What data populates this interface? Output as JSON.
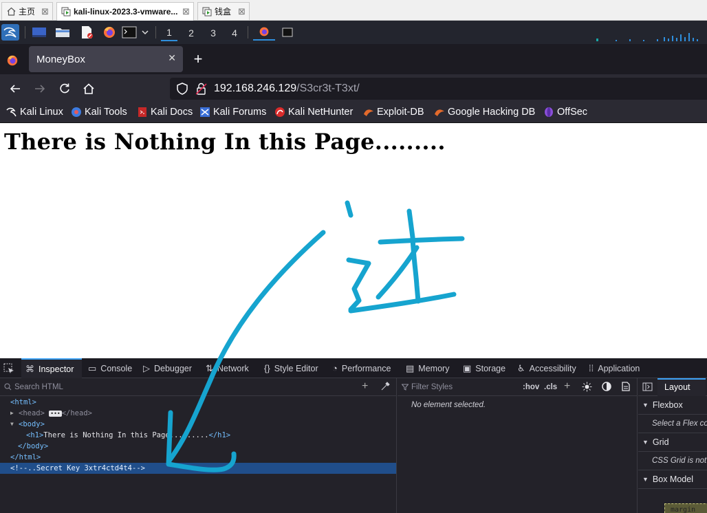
{
  "vmware": {
    "tabs": [
      {
        "label": "主页"
      },
      {
        "label": "kali-linux-2023.3-vmware..."
      },
      {
        "label": "钱盒"
      }
    ],
    "close_glyph": "⊠"
  },
  "panel": {
    "workspaces": [
      "1",
      "2",
      "3",
      "4"
    ]
  },
  "firefox": {
    "tab_title": "MoneyBox",
    "new_tab": "+",
    "url_host": "192.168.246.129",
    "url_path": "/S3cr3t-T3xt/",
    "bookmarks": [
      {
        "label": "Kali Linux",
        "icon": "kali-dragon-icon"
      },
      {
        "label": "Kali Tools",
        "icon": "kali-tools-icon"
      },
      {
        "label": "Kali Docs",
        "icon": "kali-docs-icon"
      },
      {
        "label": "Kali Forums",
        "icon": "kali-forums-icon"
      },
      {
        "label": "Kali NetHunter",
        "icon": "nethunter-icon"
      },
      {
        "label": "Exploit-DB",
        "icon": "exploitdb-icon"
      },
      {
        "label": "Google Hacking DB",
        "icon": "ghdb-icon"
      },
      {
        "label": "OffSec",
        "icon": "offsec-icon"
      }
    ]
  },
  "page": {
    "heading": "There is Nothing In this Page........."
  },
  "annotation": {
    "char": "这",
    "color": "#16a4cf"
  },
  "devtools": {
    "tabs": [
      "Inspector",
      "Console",
      "Debugger",
      "Network",
      "Style Editor",
      "Performance",
      "Memory",
      "Storage",
      "Accessibility",
      "Application"
    ],
    "search_placeholder": "Search HTML",
    "filter_placeholder": "Filter Styles",
    "hov": ":hov",
    "cls": ".cls",
    "no_element": "No element selected.",
    "layout_tab": "Layout",
    "tree": {
      "html_open": "<html>",
      "head": "<head>",
      "head_close": "</head>",
      "body_open": "<body>",
      "h1_open": "<h1>",
      "h1_text": "There is Nothing In this Page.........",
      "h1_close": "</h1>",
      "body_close": "</body>",
      "html_close": "</html>",
      "comment": "<!--..Secret Key 3xtr4ctd4t4-->"
    },
    "layout": {
      "flexbox": "Flexbox",
      "flex_hint": "Select a Flex co",
      "grid": "Grid",
      "grid_hint": "CSS Grid is not",
      "box_model": "Box Model",
      "margin": "margin"
    }
  }
}
